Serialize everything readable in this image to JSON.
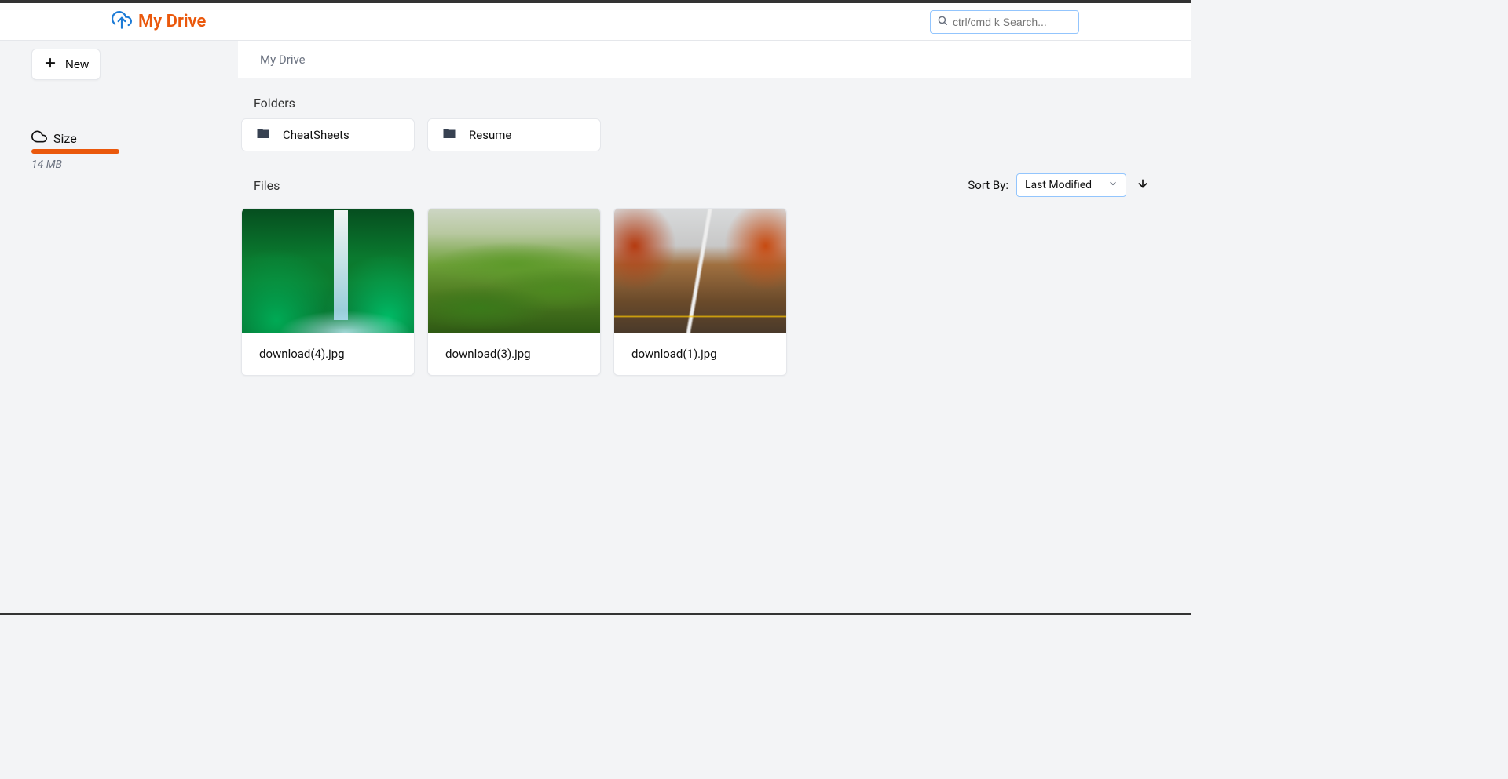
{
  "header": {
    "brand": "My Drive",
    "search_placeholder": "ctrl/cmd k Search..."
  },
  "sidebar": {
    "new_label": "New",
    "size_label": "Size",
    "size_used": "14 MB"
  },
  "breadcrumb": {
    "path": "My Drive"
  },
  "sections": {
    "folders_title": "Folders",
    "files_title": "Files"
  },
  "folders": [
    {
      "name": "CheatSheets"
    },
    {
      "name": "Resume"
    }
  ],
  "sort": {
    "label": "Sort By:",
    "selected": "Last Modified"
  },
  "files": [
    {
      "name": "download(4).jpg",
      "thumb_class": "thumb-waterfall"
    },
    {
      "name": "download(3).jpg",
      "thumb_class": "thumb-hills"
    },
    {
      "name": "download(1).jpg",
      "thumb_class": "thumb-road"
    }
  ]
}
